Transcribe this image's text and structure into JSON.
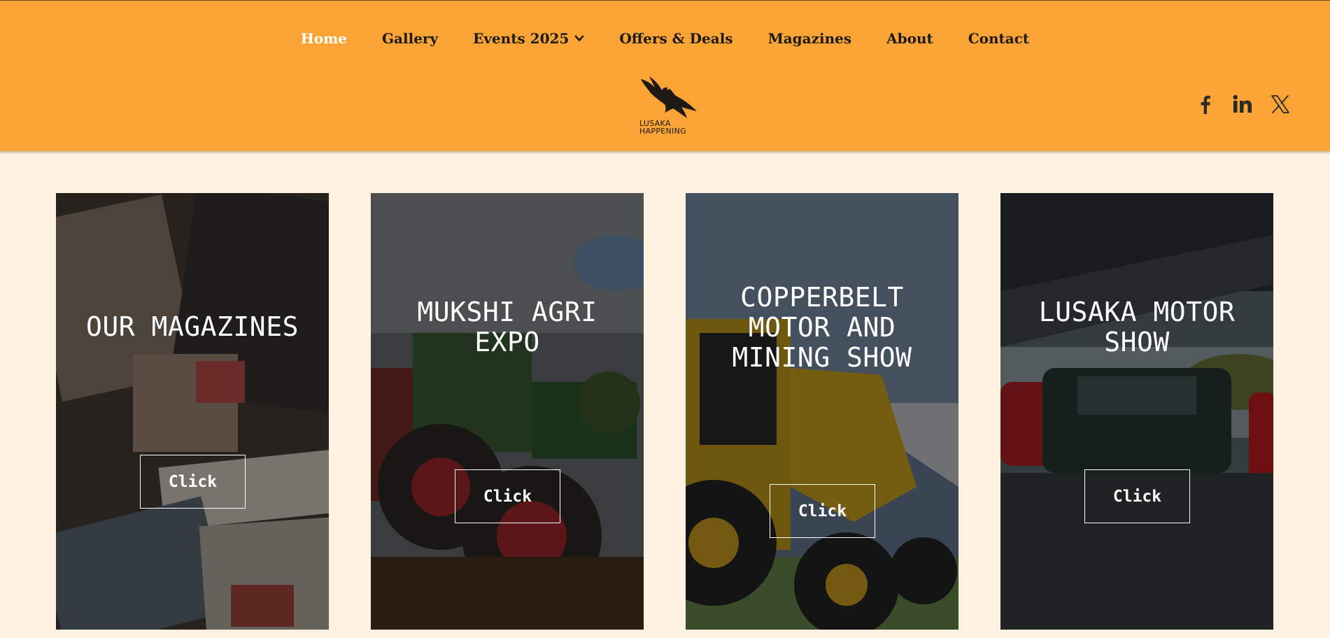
{
  "nav": {
    "items": [
      {
        "label": "Home",
        "active": true
      },
      {
        "label": "Gallery"
      },
      {
        "label": "Events 2025",
        "dropdown": true
      },
      {
        "label": "Offers & Deals"
      },
      {
        "label": "Magazines"
      },
      {
        "label": "About"
      },
      {
        "label": "Contact"
      }
    ]
  },
  "logo": {
    "line1": "LUSAKA",
    "line2": "HAPPENING",
    "icon": "eagle-icon"
  },
  "socials": [
    {
      "name": "facebook-icon"
    },
    {
      "name": "linkedin-icon"
    },
    {
      "name": "x-icon"
    }
  ],
  "colors": {
    "header": "#f9a435",
    "page": "#fef1e0",
    "active_nav": "#ffffff"
  },
  "cards": [
    {
      "title": "OUR MAGAZINES",
      "button": "Click"
    },
    {
      "title": "MUKSHI AGRI EXPO",
      "button": "Click"
    },
    {
      "title": "COPPERBELT MOTOR AND MINING SHOW",
      "button": "Click"
    },
    {
      "title": "LUSAKA MOTOR SHOW",
      "button": "Click"
    }
  ]
}
